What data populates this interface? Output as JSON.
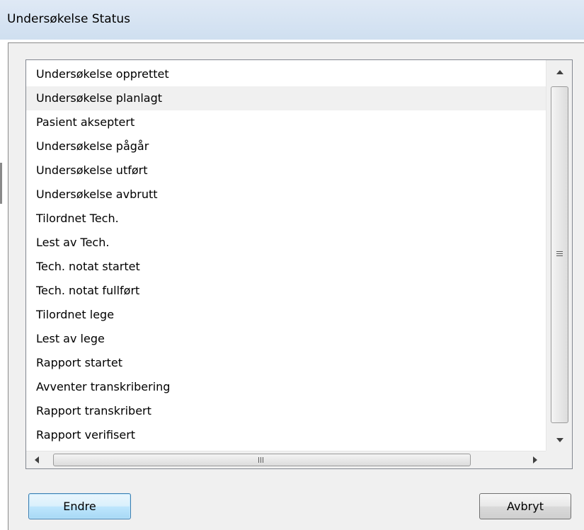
{
  "window": {
    "title": "Undersøkelse Status"
  },
  "status_list": {
    "selected_index": 1,
    "items": [
      "Undersøkelse opprettet",
      "Undersøkelse planlagt",
      "Pasient akseptert",
      "Undersøkelse pågår",
      "Undersøkelse utført",
      "Undersøkelse avbrutt",
      "Tilordnet Tech.",
      "Lest av Tech.",
      "Tech. notat startet",
      "Tech. notat fullført",
      "Tilordnet lege",
      "Lest av lege",
      "Rapport startet",
      "Avventer transkribering",
      "Rapport transkribert",
      "Rapport verifisert"
    ]
  },
  "buttons": {
    "change": "Endre",
    "cancel": "Avbryt"
  },
  "colors": {
    "selection": "#f0f0f0",
    "primary_button_border": "#3c7fb1",
    "titlebar": "#dfe9f5"
  }
}
